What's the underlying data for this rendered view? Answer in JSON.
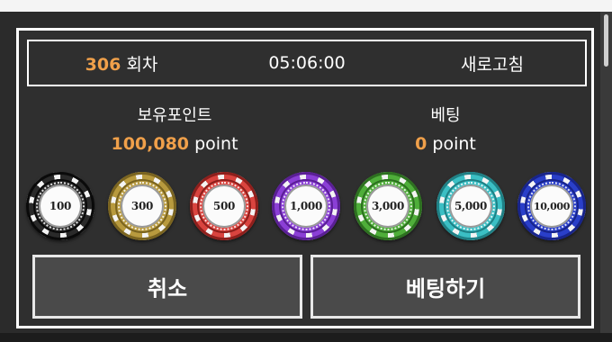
{
  "round": {
    "number": "306",
    "unit": "회차"
  },
  "timer": "05:06:00",
  "refresh_label": "새로고침",
  "balance": {
    "label": "보유포인트",
    "value": "100,080",
    "unit": "point"
  },
  "bet": {
    "label": "베팅",
    "value": "0",
    "unit": "point"
  },
  "chips": [
    {
      "value": "100",
      "color": "#2a2a2a",
      "dark": "#0a0a0a"
    },
    {
      "value": "300",
      "color": "#b89a3e",
      "dark": "#7a6420"
    },
    {
      "value": "500",
      "color": "#d9443f",
      "dark": "#8e1f1c"
    },
    {
      "value": "1,000",
      "color": "#8b3fd6",
      "dark": "#5a1f95"
    },
    {
      "value": "3,000",
      "color": "#4fae3a",
      "dark": "#2d7020"
    },
    {
      "value": "5,000",
      "color": "#3bbfc4",
      "dark": "#1f8085"
    },
    {
      "value": "10,000",
      "color": "#2a3fc9",
      "dark": "#18248a"
    }
  ],
  "buttons": {
    "cancel": "취소",
    "bet": "베팅하기"
  }
}
